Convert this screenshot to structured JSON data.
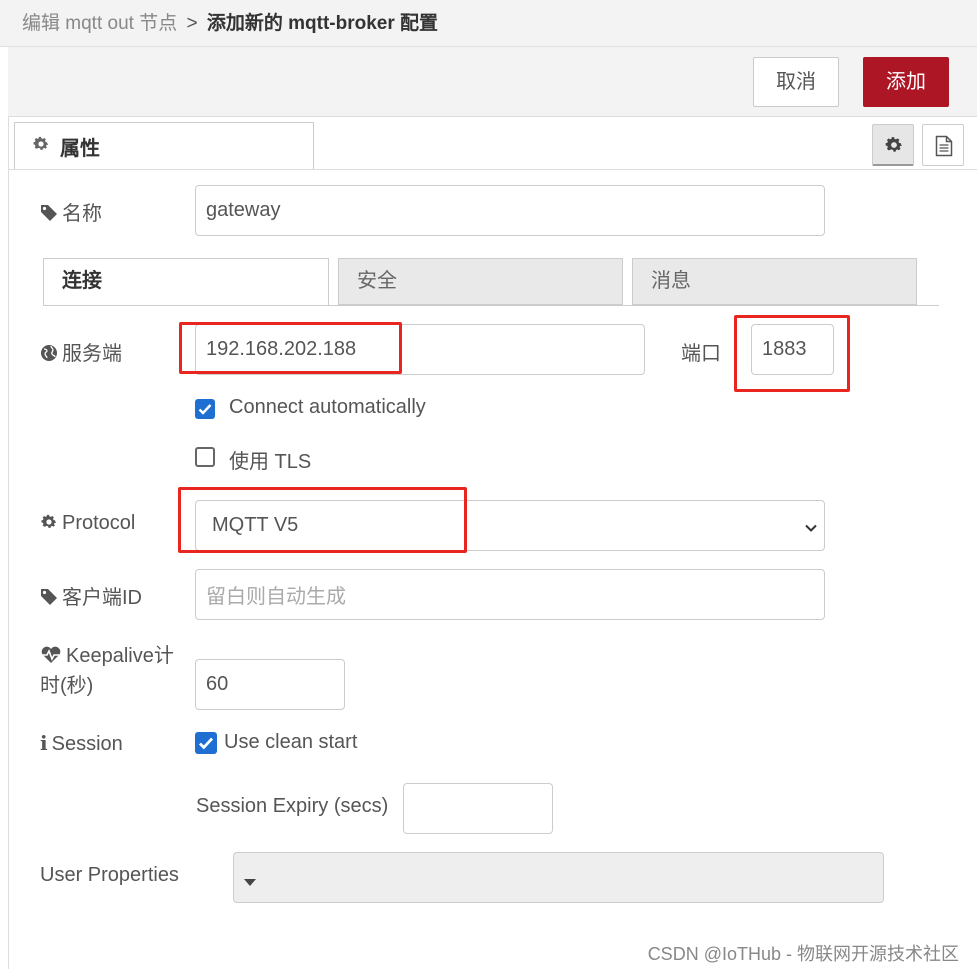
{
  "breadcrumb": {
    "parent": "编辑 mqtt out 节点",
    "separator": ">",
    "current": "添加新的 mqtt-broker 配置"
  },
  "toolbar": {
    "cancel_label": "取消",
    "add_label": "添加"
  },
  "tabs": {
    "properties_label": "属性"
  },
  "form": {
    "name_label": "名称",
    "name_value": "gateway",
    "inner_tabs": [
      "连接",
      "安全",
      "消息"
    ],
    "server_label": "服务端",
    "server_value": "192.168.202.188",
    "port_label": "端口",
    "port_value": "1883",
    "auto_connect_label": "Connect automatically",
    "auto_connect_checked": true,
    "tls_label": "使用 TLS",
    "tls_checked": false,
    "protocol_label": "Protocol",
    "protocol_value": "MQTT V5",
    "client_id_label": "客户端ID",
    "client_id_placeholder": "留白则自动生成",
    "keepalive_label_line1": "Keepalive计",
    "keepalive_label_line2": "时(秒)",
    "keepalive_value": "60",
    "session_label": "Session",
    "clean_start_label": "Use clean start",
    "clean_start_checked": true,
    "session_expiry_label": "Session Expiry (secs)",
    "session_expiry_value": "",
    "user_properties_label": "User Properties"
  },
  "watermark": "CSDN @IoTHub - 物联网开源技术社区",
  "colors": {
    "primary_button": "#ad1625",
    "highlight_box": "#e8251f",
    "checkbox_checked": "#1e6fd1"
  }
}
